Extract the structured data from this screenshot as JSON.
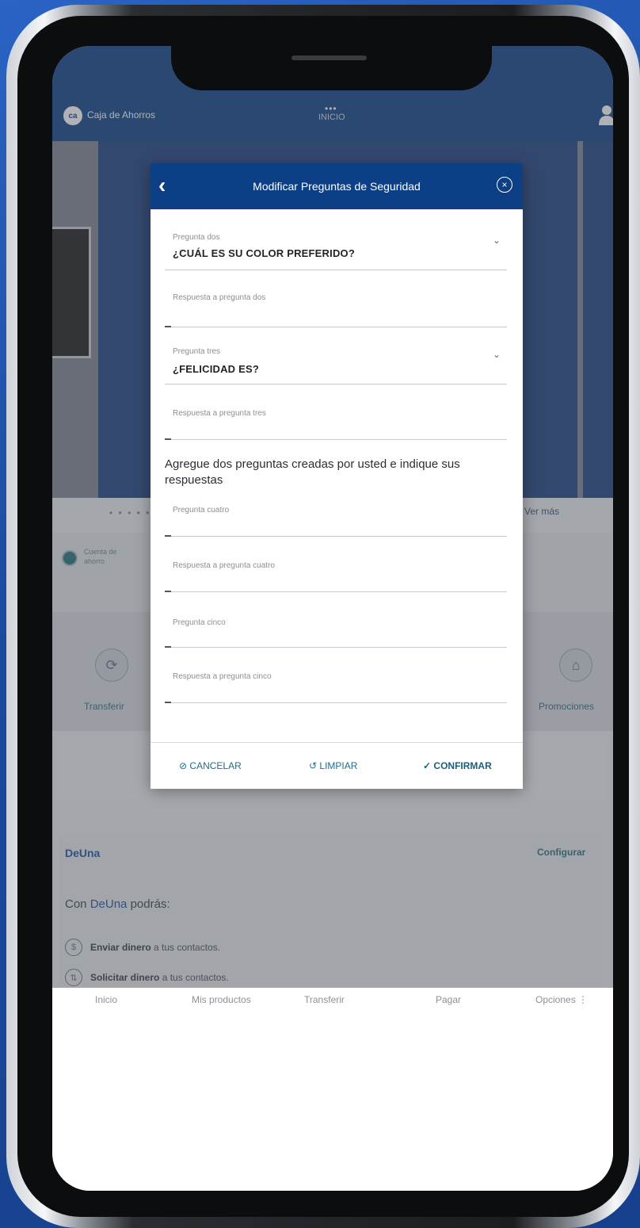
{
  "header": {
    "logo_text": "ca",
    "brand": "Caja de Ahorros",
    "center_dots": "•••",
    "center_label": "INICIO"
  },
  "banner": {
    "pager": "• • • • •",
    "see_more": "Ver más"
  },
  "account": {
    "label": "Cuenta de ahorro"
  },
  "quick_actions": [
    {
      "label": "Transferir"
    },
    {
      "label": "Promociones"
    }
  ],
  "deuna": {
    "title": "DeUna",
    "configure": "Configurar",
    "intro_prefix": "Con",
    "intro_brand": "DeUna",
    "intro_suffix": "podrás:",
    "items": [
      {
        "bold": "Enviar dinero",
        "rest": " a tus contactos.",
        "icon": "$"
      },
      {
        "bold": "Solicitar dinero",
        "rest": " a tus contactos.",
        "icon": "⇅"
      }
    ]
  },
  "bottom_nav": [
    "Inicio",
    "Mis productos",
    "Transferir",
    "Pagar",
    "Opciones ⋮"
  ],
  "modal": {
    "title": "Modificar Preguntas de Seguridad",
    "back": "‹",
    "close": "×",
    "q2_label": "Pregunta dos",
    "q2_value": "¿CUÁL ES SU COLOR PREFERIDO?",
    "a2_placeholder": "Respuesta a pregunta dos",
    "q3_label": "Pregunta tres",
    "q3_value": "¿FELICIDAD ES?",
    "a3_placeholder": "Respuesta a pregunta tres",
    "section_title": "Agregue dos preguntas creadas por usted e indique sus respuestas",
    "q4_placeholder": "Pregunta cuatro",
    "a4_placeholder": "Respuesta a pregunta cuatro",
    "q5_placeholder": "Pregunta cinco",
    "a5_placeholder": "Respuesta a pregunta cinco",
    "cancel": "CANCELAR",
    "clear": "LIMPIAR",
    "confirm": "CONFIRMAR"
  }
}
